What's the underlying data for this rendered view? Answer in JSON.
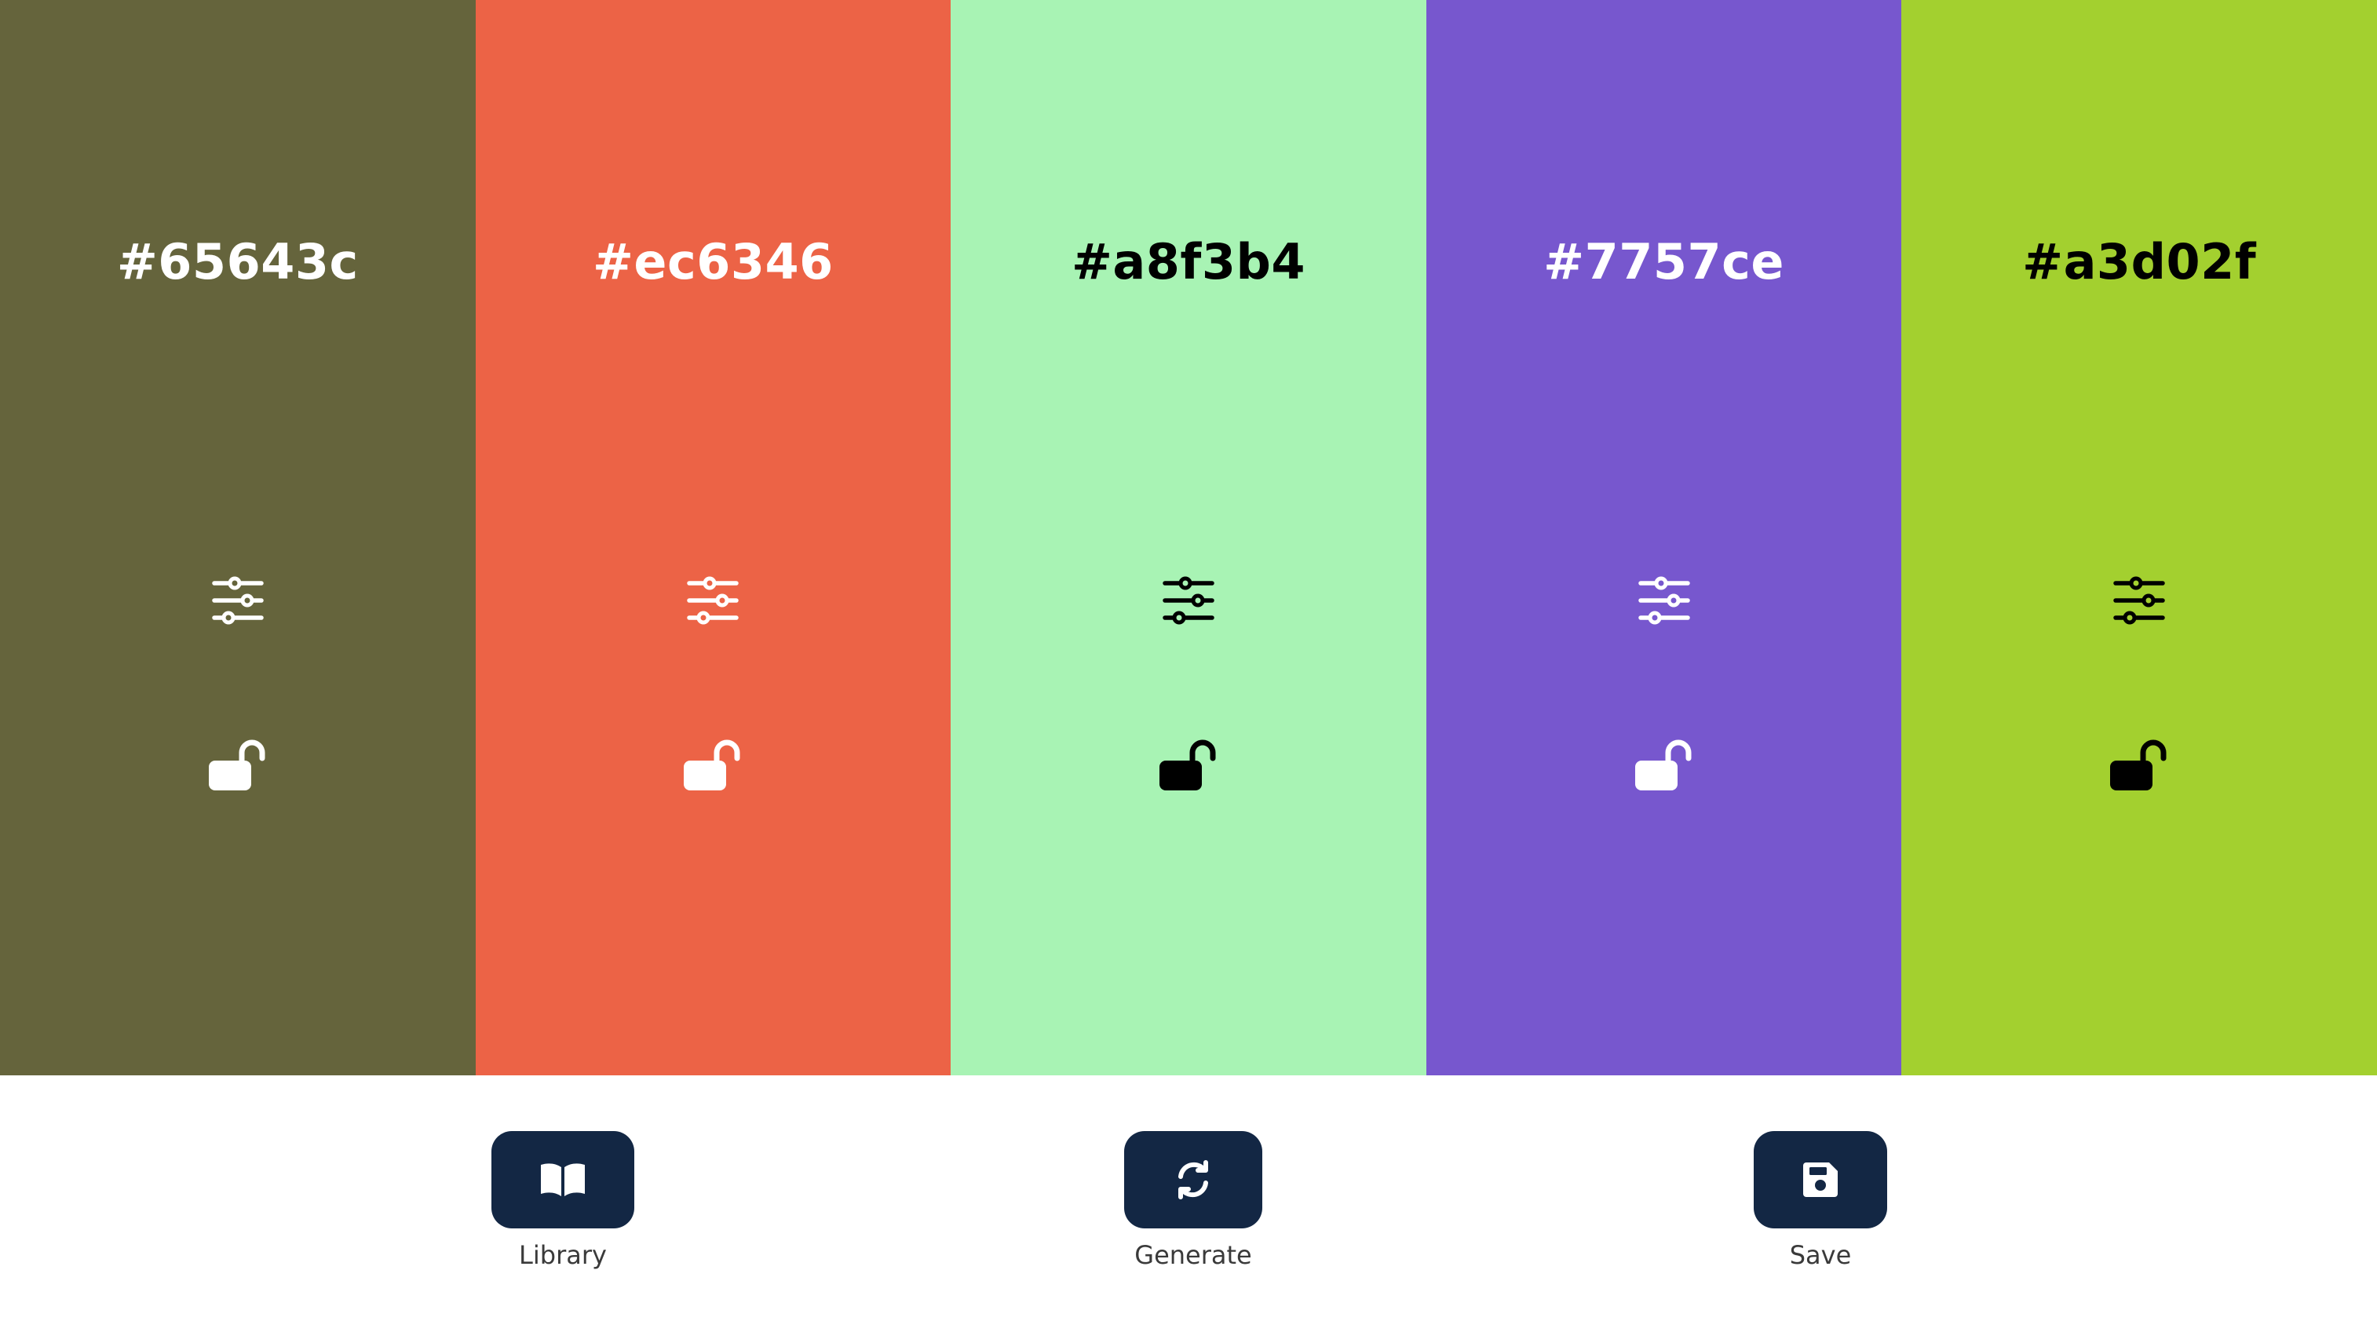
{
  "swatches": [
    {
      "hex": "#65643c",
      "bg": "#65643c",
      "fg": "#ffffff",
      "adjust_icon": "sliders-icon",
      "lock_icon": "lock-open-icon"
    },
    {
      "hex": "#ec6346",
      "bg": "#ec6346",
      "fg": "#ffffff",
      "adjust_icon": "sliders-icon",
      "lock_icon": "lock-open-icon"
    },
    {
      "hex": "#a8f3b4",
      "bg": "#a8f3b4",
      "fg": "#000000",
      "adjust_icon": "sliders-icon",
      "lock_icon": "lock-open-icon"
    },
    {
      "hex": "#7757ce",
      "bg": "#7757ce",
      "fg": "#ffffff",
      "adjust_icon": "sliders-icon",
      "lock_icon": "lock-open-icon"
    },
    {
      "hex": "#a3d02f",
      "bg": "#a3d02f",
      "fg": "#000000",
      "adjust_icon": "sliders-icon",
      "lock_icon": "lock-open-icon"
    }
  ],
  "toolbar": {
    "button_color": "#132744",
    "library": {
      "label": "Library",
      "icon": "book-open-icon"
    },
    "generate": {
      "label": "Generate",
      "icon": "refresh-icon"
    },
    "save": {
      "label": "Save",
      "icon": "floppy-disk-icon"
    }
  }
}
